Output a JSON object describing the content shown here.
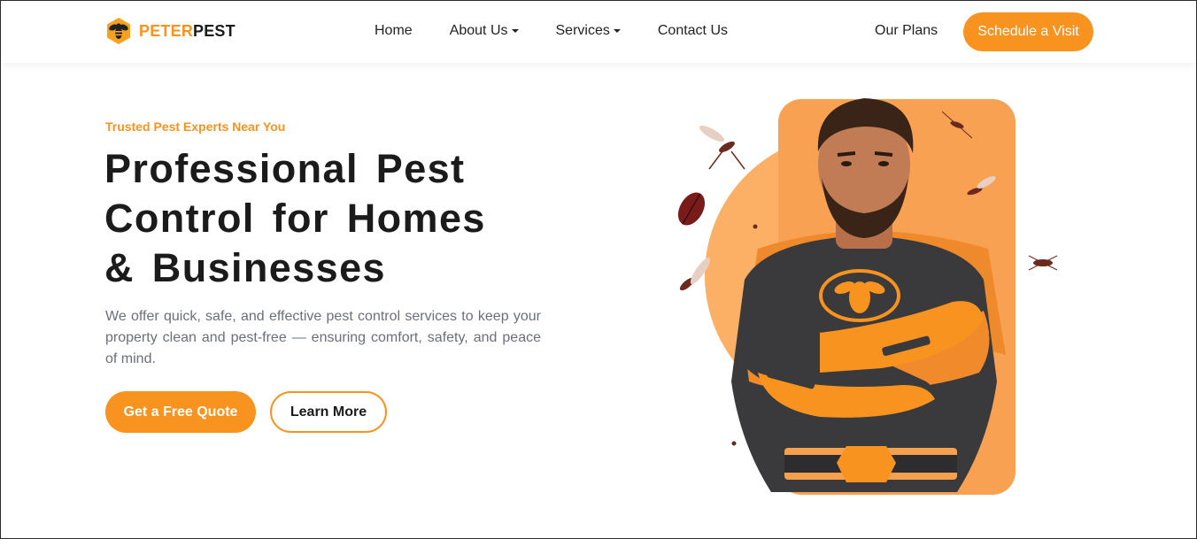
{
  "brand": {
    "name_part1": "PETER",
    "name_part2": "PEST",
    "logo_icon": "bee-hexagon-icon",
    "accent_color": "#f7931e"
  },
  "nav": {
    "items": [
      {
        "label": "Home",
        "has_dropdown": false
      },
      {
        "label": "About Us",
        "has_dropdown": true
      },
      {
        "label": "Services",
        "has_dropdown": true
      },
      {
        "label": "Contact Us",
        "has_dropdown": false
      }
    ],
    "plans_label": "Our Plans",
    "cta_label": "Schedule a Visit"
  },
  "hero": {
    "eyebrow": "Trusted Pest Experts Near You",
    "title_lines": [
      "Professional Pest",
      "Control for Homes",
      "& Businesses"
    ],
    "description": "We offer quick, safe, and effective pest control services to keep your property clean and pest-free — ensuring comfort, safety, and peace of mind.",
    "primary_button": "Get a Free Quote",
    "secondary_button": "Learn More",
    "illustration": "pest-control-superhero-illustration"
  },
  "colors": {
    "accent": "#f7931e",
    "heading": "#1b1b1b",
    "body_text": "#6a6f7a"
  }
}
